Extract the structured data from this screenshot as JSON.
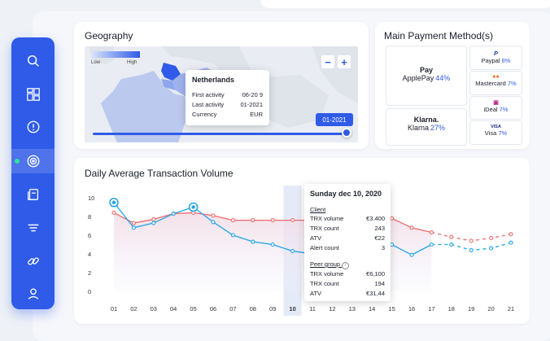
{
  "sidebar": {
    "items": [
      {
        "name": "search-icon"
      },
      {
        "name": "dashboard-grid-icon"
      },
      {
        "name": "alert-icon"
      },
      {
        "name": "monitoring-icon",
        "active": true
      },
      {
        "name": "documents-icon"
      },
      {
        "name": "filter-icon"
      },
      {
        "name": "link-icon"
      },
      {
        "name": "user-icon"
      }
    ]
  },
  "geography": {
    "title": "Geography",
    "legend_low": "Low",
    "legend_high": "High",
    "zoom_out": "−",
    "zoom_in": "+",
    "tooltip": {
      "country": "Netherlands",
      "rows": [
        {
          "label": "First activity",
          "value": "06-20 9"
        },
        {
          "label": "Last activity",
          "value": "01-2021"
        },
        {
          "label": "Currency",
          "value": "EUR"
        }
      ]
    },
    "date_button": "01-2021",
    "slider_position": 1.0
  },
  "payments": {
    "title": "Main Payment Method(s)",
    "methods": [
      {
        "logo": " Pay",
        "name": "ApplePay",
        "pct": "44%"
      },
      {
        "logo": "Klarna.",
        "name": "Klarna",
        "pct": "27%"
      },
      {
        "logo": "P",
        "name": "Paypal",
        "pct": "8%"
      },
      {
        "logo": "●●",
        "name": "Mastercard",
        "pct": "7%"
      },
      {
        "logo": "▣",
        "name": "iDeal",
        "pct": "7%"
      },
      {
        "logo": "VISA",
        "name": "Visa",
        "pct": "7%"
      }
    ]
  },
  "chart": {
    "title": "Daily Average Transaction Volume",
    "tooltip": {
      "date": "Sunday dec 10, 2020",
      "client_label": "Client",
      "client_rows": [
        {
          "label": "TRX volume",
          "value": "€3.400"
        },
        {
          "label": "TRX count",
          "value": "243"
        },
        {
          "label": "ATV",
          "value": "€22"
        },
        {
          "label": "Alert count",
          "value": "3"
        }
      ],
      "peer_label": "Peer group",
      "peer_rows": [
        {
          "label": "TRX volume",
          "value": "€6,100"
        },
        {
          "label": "TRX count",
          "value": "194"
        },
        {
          "label": "ATV",
          "value": "€31,44"
        }
      ]
    }
  },
  "chart_data": {
    "type": "line",
    "title": "Daily Average Transaction Volume",
    "categories": [
      "01",
      "02",
      "03",
      "04",
      "05",
      "06",
      "07",
      "08",
      "09",
      "10",
      "11",
      "12",
      "13",
      "14",
      "15",
      "16",
      "17",
      "18",
      "19",
      "20",
      "21"
    ],
    "tick_labels": [
      "01",
      "02",
      "03",
      "04",
      "05",
      "06",
      "07",
      "08",
      "09",
      "10",
      "11",
      "12",
      "13",
      "14",
      "15",
      "16",
      "17",
      "18",
      "19",
      "20",
      "21"
    ],
    "x_tick_labels": [
      "01",
      "02",
      "03",
      "04",
      "05",
      "06",
      "07",
      "08",
      "09",
      "10",
      "11",
      "12",
      "13",
      "14",
      "15",
      "16",
      "17",
      "18",
      "19",
      "20",
      "21"
    ],
    "y_ticks": [
      0,
      2,
      4,
      6,
      8,
      10
    ],
    "ylim": [
      0,
      10
    ],
    "highlighted_category": "10",
    "forecast_from_index": 16,
    "series": [
      {
        "values": [
          8.4,
          7.3,
          7.7,
          8.3,
          8.4,
          8.1,
          7.6,
          7.6,
          7.6,
          7.6,
          7.6,
          7.8,
          8.0,
          8.1,
          7.8,
          6.8,
          6.3,
          5.8,
          5.4,
          5.7,
          6.1
        ],
        "color": "#ef6a6a"
      },
      {
        "values": [
          9.5,
          6.8,
          7.3,
          8.3,
          9.0,
          7.4,
          6.0,
          5.3,
          5.0,
          4.3,
          4.0,
          4.3,
          4.5,
          4.6,
          5.0,
          3.9,
          5.0,
          5.0,
          4.4,
          4.6,
          5.2
        ],
        "color": "#1fa3e8",
        "markers_large_at": [
          0,
          4
        ]
      }
    ]
  },
  "colors": {
    "accent": "#2f5be8",
    "client_line": "#1fa3e8",
    "peer_line": "#ef6a6a",
    "status_dot": "#2ee59d"
  }
}
